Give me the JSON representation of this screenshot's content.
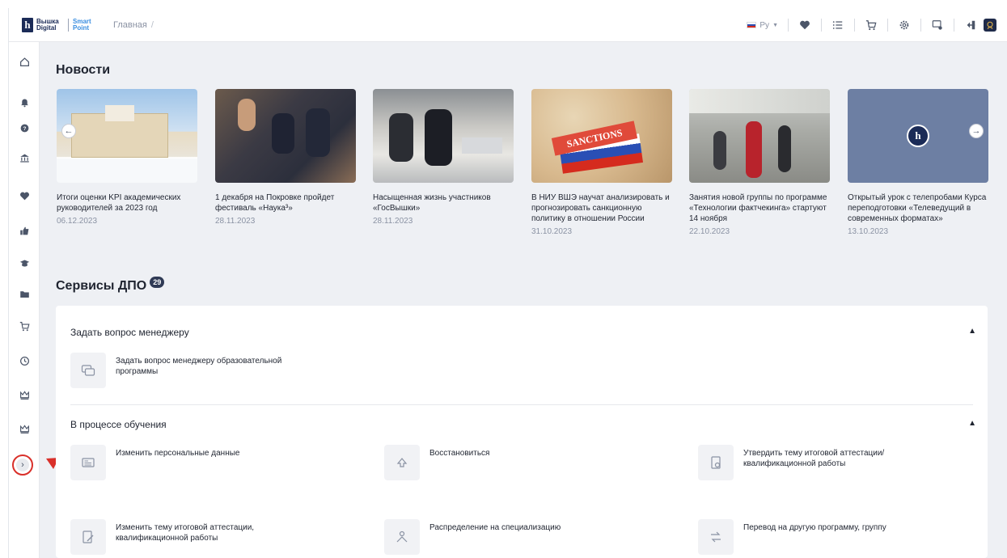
{
  "header": {
    "logo_main": "Вышка Digital",
    "logo_secondary": "Smart Point",
    "breadcrumb": "Главная",
    "breadcrumb_sep": "/",
    "language": "Ру"
  },
  "news": {
    "title": "Новости",
    "items": [
      {
        "title": "Итоги оценки KPI академических руководителей за 2023 год",
        "date": "06.12.2023"
      },
      {
        "title": "1 декабря на Покровке пройдет фестиваль «Наука³»",
        "date": "28.11.2023"
      },
      {
        "title": "Насыщенная жизнь участников «ГосВышки»",
        "date": "28.11.2023"
      },
      {
        "title": "В НИУ ВШЭ научат анализировать и прогнозировать санкционную политику в отношении России",
        "date": "31.10.2023",
        "image_text": "SANCTIONS"
      },
      {
        "title": "Занятия новой группы по программе «Технологии фактчекинга» стартуют 14 ноября",
        "date": "22.10.2023"
      },
      {
        "title": "Открытый урок с телепробами Курса переподготовки «Телеведущий в современных форматах»",
        "date": "13.10.2023"
      }
    ]
  },
  "services": {
    "title": "Сервисы ДПО",
    "count": "29",
    "sections": [
      {
        "title": "Задать вопрос менеджеру",
        "items": [
          "Задать вопрос менеджеру образовательной программы"
        ]
      },
      {
        "title": "В процессе обучения",
        "items": [
          "Изменить персональные данные",
          "Восстановиться",
          "Утвердить тему итоговой аттестации/ квалификационной работы",
          "Изменить тему итоговой аттестации, квалификационной работы",
          "Распределение на специализацию",
          "Перевод на другую программу, группу"
        ]
      }
    ]
  },
  "colors": {
    "highlight": "#d9302a",
    "brand": "#1b2b57",
    "accent": "#3a8ee0"
  }
}
